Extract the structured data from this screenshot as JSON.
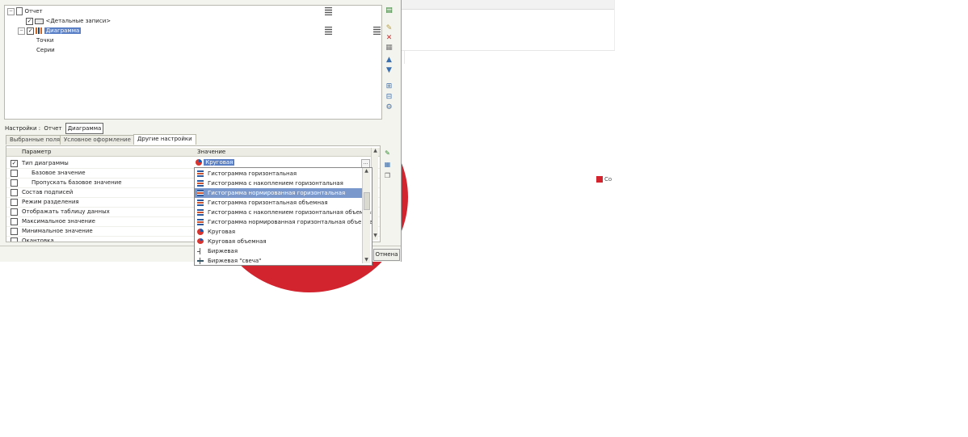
{
  "background": {
    "chart_color": "#d2242f",
    "legend_label": "Co"
  },
  "structure_tree": {
    "items": [
      {
        "label": "Отчет",
        "icon": "document-icon"
      },
      {
        "label": "<Детальные записи>",
        "icon": "records-icon",
        "checked": true
      },
      {
        "label": "Диаграмма",
        "icon": "chart-icon",
        "checked": true,
        "selected": true
      },
      {
        "label": "Точки"
      },
      {
        "label": "Серии"
      }
    ]
  },
  "settings_bar": {
    "label": "Настройки :",
    "options": [
      "Отчет",
      "Диаграмма"
    ],
    "active": "Диаграмма"
  },
  "tabs": [
    "Выбранные поля",
    "Условное оформление",
    "Другие настройки"
  ],
  "active_tab": "Другие настройки",
  "grid": {
    "col_parameter": "Параметр",
    "col_value": "Значение",
    "rows": [
      {
        "label": "Тип диаграммы",
        "checked": true
      },
      {
        "label": "Базовое значение"
      },
      {
        "label": "Пропускать базовое значение"
      },
      {
        "label": "Состав подписей"
      },
      {
        "label": "Режим разделения"
      },
      {
        "label": "Отображать таблицу данных"
      },
      {
        "label": "Максимальное значение"
      },
      {
        "label": "Минимальное значение"
      },
      {
        "label": "Окантовка"
      }
    ]
  },
  "combo": {
    "value": "Круговая",
    "ellipsis": "..."
  },
  "dropdown": {
    "selected_index": 2,
    "options": [
      {
        "label": "Гистограмма горизонтальная",
        "icon": "hbar-icon"
      },
      {
        "label": "Гистограмма с накоплением горизонтальная",
        "icon": "hbar-stacked-icon"
      },
      {
        "label": "Гистограмма нормированная горизонтальная",
        "icon": "hbar-normalized-icon"
      },
      {
        "label": "Гистограмма горизонтальная объемная",
        "icon": "hbar-3d-icon"
      },
      {
        "label": "Гистограмма с накоплением горизонтальная объемная",
        "icon": "hbar-stacked-3d-icon"
      },
      {
        "label": "Гистограмма нормированная горизонтальная объемная",
        "icon": "hbar-normalized-3d-icon"
      },
      {
        "label": "Круговая",
        "icon": "pie-icon"
      },
      {
        "label": "Круговая объемная",
        "icon": "pie-3d-icon"
      },
      {
        "label": "Биржевая",
        "icon": "stock-icon"
      },
      {
        "label": "Биржевая \"свеча\"",
        "icon": "candlestick-icon"
      }
    ]
  },
  "buttons": {
    "cancel": "Отмена"
  }
}
